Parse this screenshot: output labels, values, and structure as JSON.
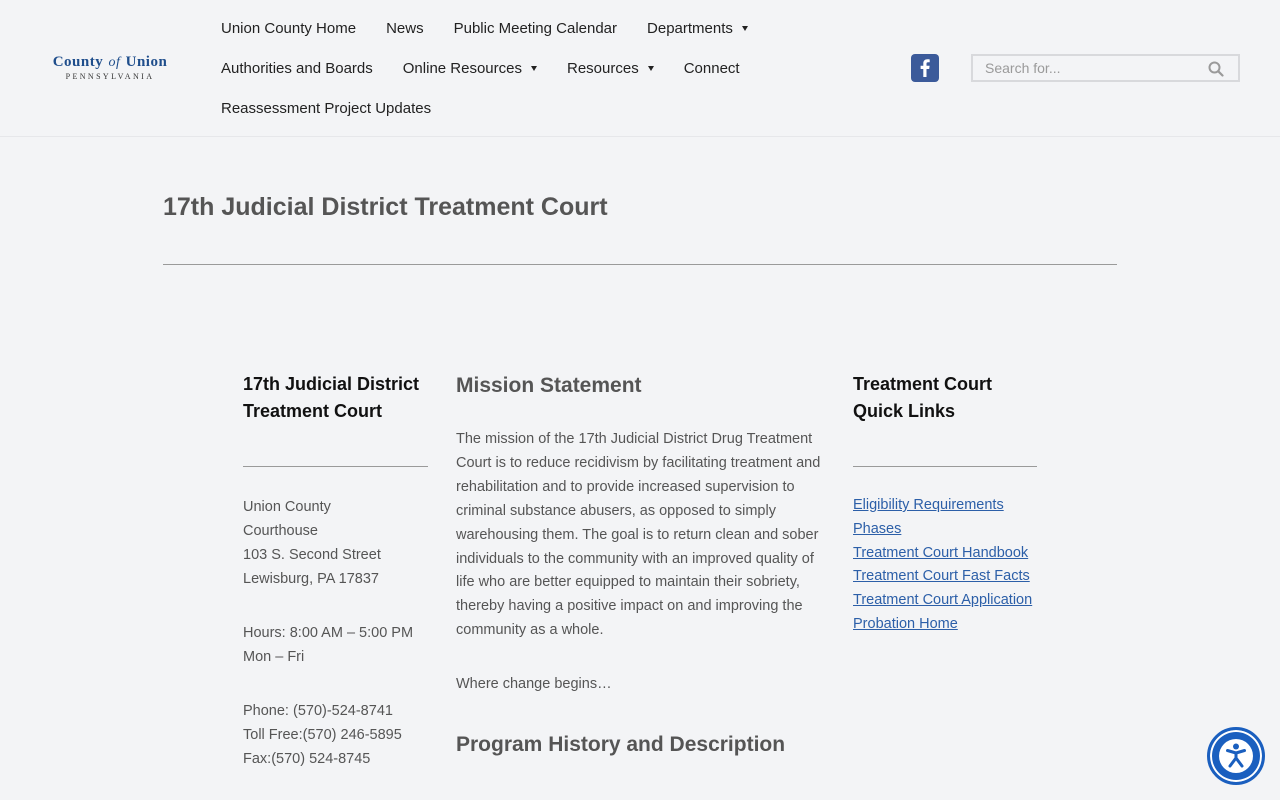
{
  "header": {
    "logo": {
      "county": "County",
      "of": "of",
      "union": "Union",
      "state": "PENNSYLVANIA"
    },
    "nav_rows": [
      [
        {
          "label": "Union County Home",
          "dropdown": false
        },
        {
          "label": "News",
          "dropdown": false
        },
        {
          "label": "Public Meeting Calendar",
          "dropdown": false
        },
        {
          "label": "Departments",
          "dropdown": true
        }
      ],
      [
        {
          "label": "Authorities and Boards",
          "dropdown": false
        },
        {
          "label": "Online Resources",
          "dropdown": true
        },
        {
          "label": "Resources",
          "dropdown": true
        },
        {
          "label": "Connect",
          "dropdown": false
        }
      ],
      [
        {
          "label": "Reassessment Project Updates",
          "dropdown": false
        }
      ]
    ],
    "social_icon": "facebook-icon",
    "search": {
      "placeholder": "Search for...",
      "value": ""
    }
  },
  "page": {
    "title": "17th Judicial District Treatment Court"
  },
  "left_col": {
    "heading": "17th Judicial District Treatment Court",
    "address": [
      "Union County",
      "Courthouse",
      "103 S. Second Street",
      "Lewisburg, PA 17837"
    ],
    "hours": [
      "Hours: 8:00 AM – 5:00 PM",
      "Mon – Fri"
    ],
    "phones": [
      "Phone: (570)-524-8741",
      "Toll Free:(570) 246-5895",
      "Fax:(570) 524-8745"
    ]
  },
  "center_col": {
    "heading": "Mission Statement",
    "mission_text": "The mission of the 17th Judicial District Drug Treatment Court is to reduce recidivism by facilitating treatment and rehabilitation and to provide increased supervision to criminal substance abusers, as opposed to simply warehousing them. The goal is to return clean and sober individuals to the community with an improved quality of life who are better equipped to maintain their sobriety, thereby having a positive impact on and improving the community as a whole.",
    "tagline": "Where change begins…",
    "heading2": "Program History and Description"
  },
  "right_col": {
    "heading": "Treatment Court Quick Links",
    "links": [
      "Eligibility Requirements",
      "Phases",
      "Treatment Court Handbook",
      "Treatment Court Fast Facts",
      "Treatment Court Application",
      "Probation Home"
    ]
  },
  "accessibility": {
    "icon": "accessibility-icon"
  },
  "colors": {
    "background": "#f3f4f6",
    "link": "#2c5fa8",
    "brand_blue": "#1f4e8c",
    "facebook": "#3b5a9a",
    "accessibility": "#1a5fbf"
  }
}
